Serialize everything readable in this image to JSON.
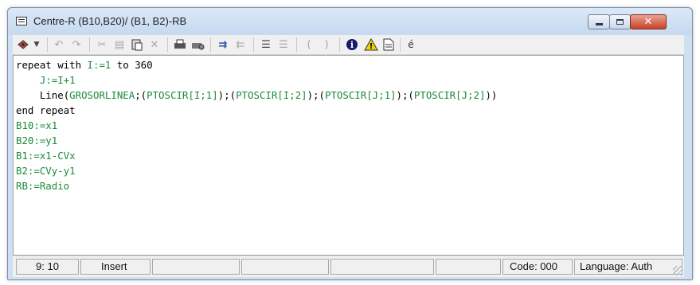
{
  "window": {
    "title": "Centre-R (B10,B20)/ (B1, B2)-RB"
  },
  "caption_buttons": {
    "minimize": "",
    "maximize": "",
    "close": "✕"
  },
  "toolbar": {
    "icons": [
      "bug-icon",
      "dropdown-arrow-icon",
      "undo-icon",
      "redo-icon",
      "cut-icon",
      "copy-icon",
      "paste-icon",
      "delete-icon",
      "print-icon",
      "print-setup-icon",
      "indent-icon",
      "unindent-icon",
      "comment-icon",
      "uncomment-icon",
      "open-paren-icon",
      "close-paren-icon",
      "info-icon",
      "warning-icon",
      "page-icon",
      "accent-e-icon"
    ],
    "open_paren": "(",
    "close_paren": ")",
    "accent_char": "é"
  },
  "editor": {
    "lines": [
      {
        "kw": "repeat with ",
        "var": "I:=1",
        "rest": " to 360"
      },
      {
        "indent": "    ",
        "var": "J:=I+1"
      },
      {
        "indent": "    ",
        "fn": "Line",
        "open": "(",
        "a1": "GROSORLINEA",
        "s1": ";(",
        "a2": "PTOSCIR[I;1]",
        "s2": ");(",
        "a3": "PTOSCIR[I;2]",
        "s3": ");(",
        "a4": "PTOSCIR[J;1]",
        "s4": ");(",
        "a5": "PTOSCIR[J;2]",
        "end": "))"
      },
      {
        "kw": "end repeat"
      },
      {
        "var": "B10:=x1"
      },
      {
        "var": "B20:=y1"
      },
      {
        "var": "B1:=x1-CVx"
      },
      {
        "var": "B2:=CVy-y1"
      },
      {
        "var": "RB:=Radio"
      }
    ]
  },
  "status": {
    "position": "9: 10",
    "mode": "Insert",
    "code": "Code: 000",
    "language": "Language: Auth"
  }
}
